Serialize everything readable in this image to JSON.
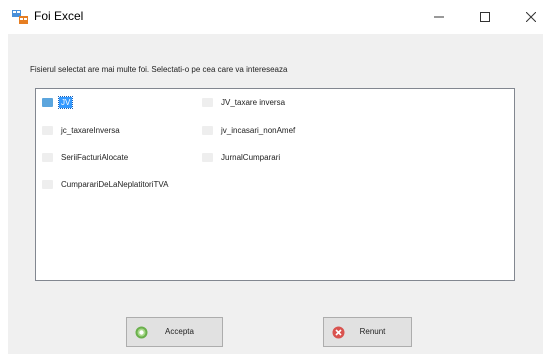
{
  "window": {
    "title": "Foi Excel",
    "icon": "excel-sheets-icon"
  },
  "instruction": "Fisierul selectat are mai multe foi. Selectati-o pe cea care va intereseaza",
  "sheets": [
    {
      "label": "JV",
      "selected": true,
      "icon": "folder-icon"
    },
    {
      "label": "JV_taxare inversa",
      "selected": false,
      "icon": "sheet-icon"
    },
    {
      "label": "jc_taxareInversa",
      "selected": false,
      "icon": "sheet-icon"
    },
    {
      "label": "jv_incasari_nonAmef",
      "selected": false,
      "icon": "sheet-icon"
    },
    {
      "label": "SeriiFacturiAlocate",
      "selected": false,
      "icon": "sheet-icon"
    },
    {
      "label": "JurnalCumparari",
      "selected": false,
      "icon": "sheet-icon"
    },
    {
      "label": "CumparariDeLaNeplatitoriTVA",
      "selected": false,
      "icon": "sheet-icon"
    }
  ],
  "buttons": {
    "accept_label": "Accepta",
    "cancel_label": "Renunt"
  },
  "colors": {
    "selection": "#3399ff",
    "accept_icon": "#6ab04c",
    "cancel_icon": "#d9534f",
    "dialog_bg": "#f0f0f0"
  }
}
